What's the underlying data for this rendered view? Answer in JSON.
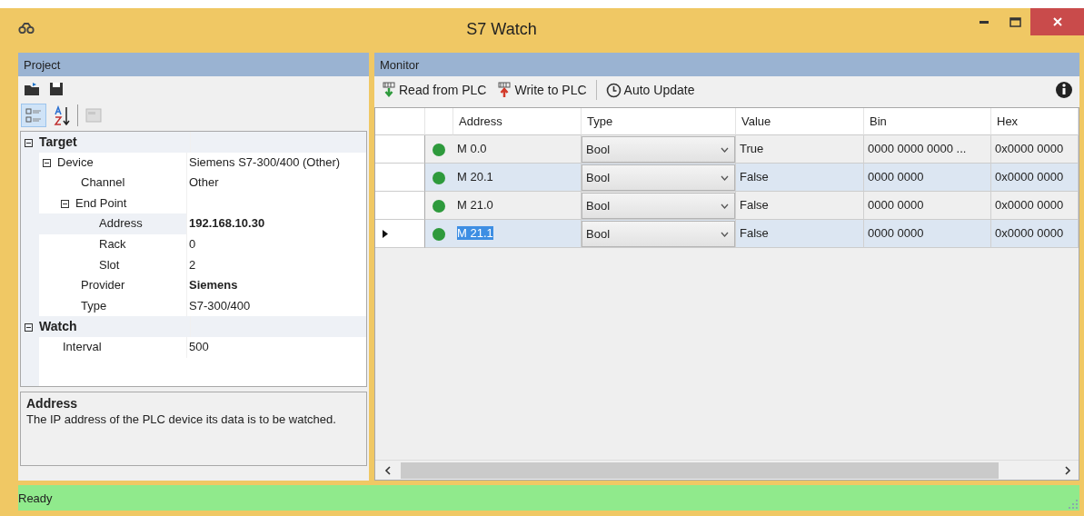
{
  "window": {
    "title": "S7 Watch"
  },
  "project": {
    "title": "Project",
    "properties": [
      {
        "label": "Target",
        "kind": "category",
        "expanded": true,
        "children": [
          {
            "label": "Device",
            "value": "Siemens S7-300/400 (Other)",
            "modified": false,
            "selected": false,
            "expanded": true,
            "children": [
              {
                "label": "Channel",
                "value": "Other",
                "modified": false,
                "selected": false
              },
              {
                "label": "End Point",
                "expanded": true,
                "selected": false,
                "children": [
                  {
                    "label": "Address",
                    "value": "192.168.10.30",
                    "modified": true,
                    "selected": true
                  },
                  {
                    "label": "Rack",
                    "value": "0",
                    "modified": false,
                    "selected": false
                  },
                  {
                    "label": "Slot",
                    "value": "2",
                    "modified": false,
                    "selected": false
                  }
                ]
              },
              {
                "label": "Provider",
                "value": "Siemens",
                "modified": true,
                "selected": false
              },
              {
                "label": "Type",
                "value": "S7-300/400",
                "modified": false,
                "selected": false
              }
            ]
          }
        ]
      },
      {
        "label": "Watch",
        "kind": "category",
        "expanded": true,
        "children": [
          {
            "label": "Interval",
            "value": "500",
            "modified": false,
            "selected": false
          }
        ]
      }
    ],
    "description": {
      "title": "Address",
      "text": "The IP address of the PLC device its data is to be watched."
    }
  },
  "monitor": {
    "title": "Monitor",
    "toolbar": [
      {
        "label": "Read from PLC",
        "kind": "read"
      },
      {
        "label": "Write to PLC",
        "kind": "write"
      },
      {
        "label": "Auto Update",
        "kind": "auto"
      }
    ],
    "columns": [
      "Address",
      "Type",
      "Value",
      "Bin",
      "Hex"
    ],
    "rows": [
      {
        "color": "#2e9a3c",
        "address": "M 0.0",
        "type": "Bool",
        "value": "True",
        "bin": "0000 0000 0000 ...",
        "hex": "0x0000 0000",
        "current": false
      },
      {
        "color": "#2e9a3c",
        "address": "M 20.1",
        "type": "Bool",
        "value": "False",
        "bin": "0000 0000",
        "hex": "0x0000 0000",
        "current": false
      },
      {
        "color": "#2e9a3c",
        "address": "M 21.0",
        "type": "Bool",
        "value": "False",
        "bin": "0000 0000",
        "hex": "0x0000 0000",
        "current": false
      },
      {
        "color": "#2e9a3c",
        "address": "M 21.1",
        "type": "Bool",
        "value": "False",
        "bin": "0000 0000",
        "hex": "0x0000 0000",
        "current": true
      }
    ]
  },
  "status_bar": {
    "text": "Ready"
  }
}
